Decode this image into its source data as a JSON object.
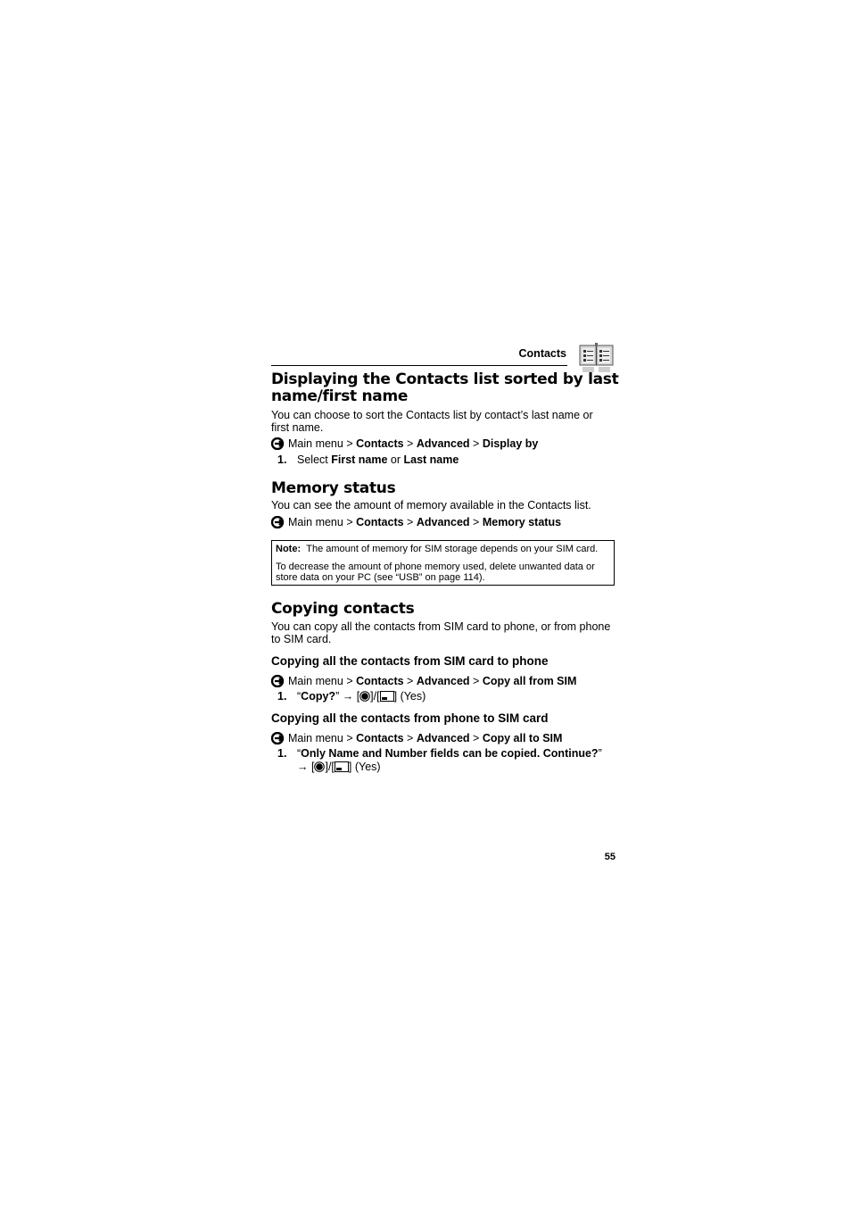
{
  "header": {
    "chapter_title": "Contacts",
    "chapter_icon": "contacts-book-icon"
  },
  "section1": {
    "heading_line1": "Displaying the Contacts list sorted by last",
    "heading_line2": "name/first name",
    "body_line1": "You can choose to sort the Contacts list by contact’s last name or",
    "body_line2": "first name.",
    "nav": {
      "icon": "menu-path-arrow-icon",
      "main": "Main menu",
      "sep": " > ",
      "items": [
        "Contacts",
        "Advanced",
        "Display by"
      ]
    },
    "steps": [
      {
        "num": "1.",
        "pre": "Select ",
        "opt1": "First name",
        "mid": " or ",
        "opt2": "Last name"
      }
    ]
  },
  "section2": {
    "heading": "Memory status",
    "body": "You can see the amount of memory available in the Contacts list.",
    "nav": {
      "main": "Main menu",
      "sep": " > ",
      "items": [
        "Contacts",
        "Advanced",
        "Memory status"
      ]
    },
    "note": {
      "label": "Note:",
      "line1": "The amount of memory for SIM storage depends on your SIM card.",
      "line2": "To decrease the amount of phone memory used, delete unwanted data or",
      "line3": "store data on your PC (see “USB” on page 114)."
    }
  },
  "section3": {
    "heading": "Copying contacts",
    "body_line1": "You can copy all the contacts from SIM card to phone, or from phone",
    "body_line2": "to SIM card.",
    "sub1": {
      "heading": "Copying all the contacts from SIM card to phone",
      "nav": {
        "main": "Main menu",
        "sep": " > ",
        "items": [
          "Contacts",
          "Advanced",
          "Copy all from SIM"
        ]
      },
      "step": {
        "num": "1.",
        "open_quote": "“",
        "prompt": "Copy?",
        "close_quote": "”",
        "arrow": "→",
        "keys": [
          "center-key-icon",
          "left-soft-key-icon"
        ],
        "slash": "/",
        "result": "(Yes)"
      }
    },
    "sub2": {
      "heading": "Copying all the contacts from phone to SIM card",
      "nav": {
        "main": "Main menu",
        "sep": " > ",
        "items": [
          "Contacts",
          "Advanced",
          "Copy all to SIM"
        ]
      },
      "step": {
        "num": "1.",
        "open_quote": "“",
        "prompt": "Only Name and Number fields can be copied. Continue?",
        "close_quote": "”",
        "arrow": "→",
        "slash": "/",
        "result": "(Yes)"
      }
    }
  },
  "footer": {
    "page_number": "55"
  }
}
